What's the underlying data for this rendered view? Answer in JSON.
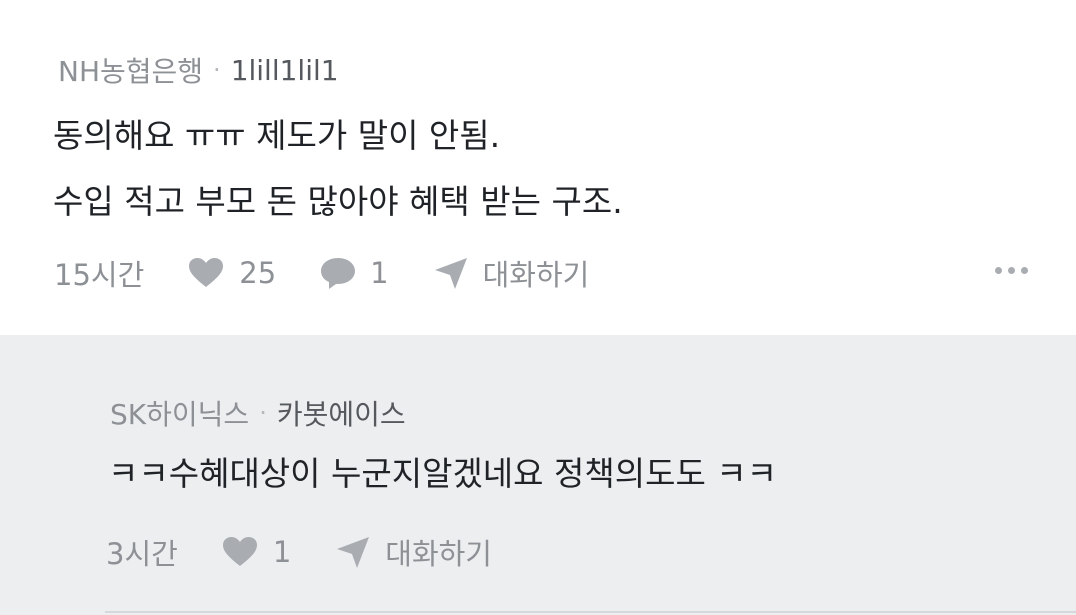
{
  "comment": {
    "company": "NH농협은행",
    "separator": "·",
    "nickname": "1lill1lil1",
    "lines": [
      "동의해요 ㅠㅠ 제도가 말이 안됨.",
      "수입 적고 부모 돈 많아야 혜택 받는 구조."
    ],
    "time": "15시간",
    "likes": "25",
    "replies": "1",
    "chat_label": "대화하기",
    "more_icon": "more-horizontal-icon"
  },
  "reply": {
    "company": "SK하이닉스",
    "separator": "·",
    "nickname": "카봇에이스",
    "text": "ㅋㅋ수혜대상이 누군지알겠네요 정책의도도 ㅋㅋ",
    "time": "3시간",
    "likes": "1",
    "chat_label": "대화하기"
  },
  "colors": {
    "meta_gray": "#8d9196",
    "nickname": "#55595e",
    "body_text": "#1f2226",
    "reply_bg": "#eceef0",
    "icon_gray": "#a9adb2"
  }
}
